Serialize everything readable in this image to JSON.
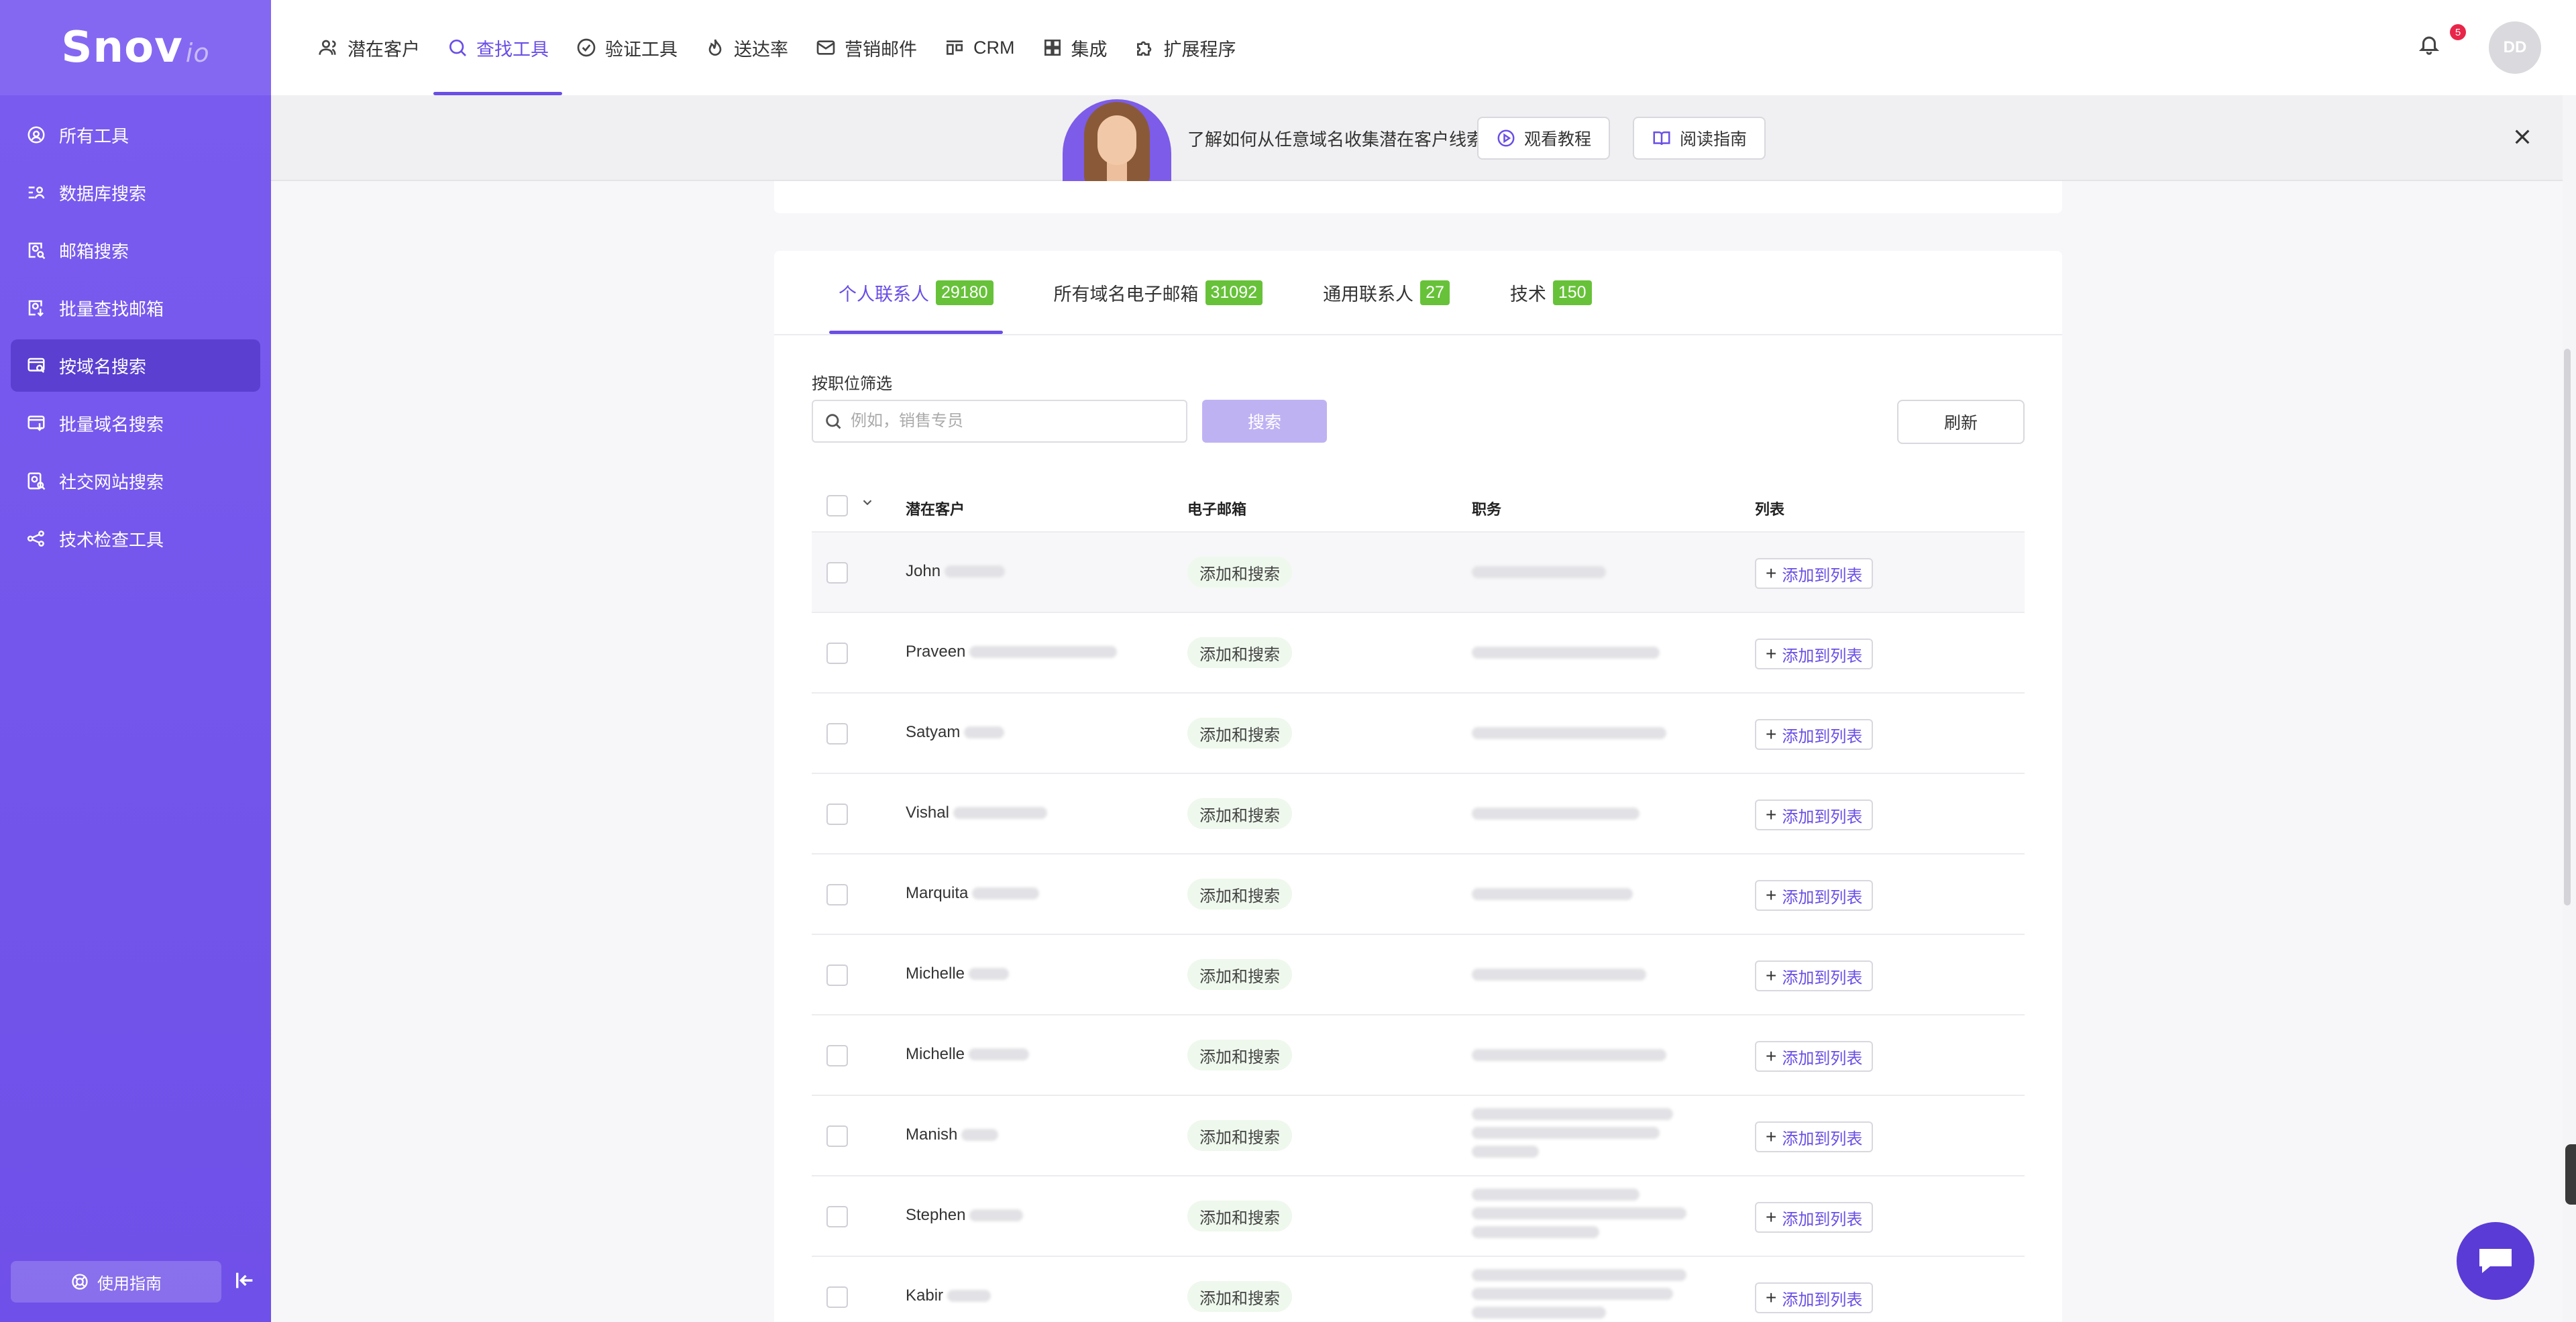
{
  "sidebar": {
    "logo_main": "Snov",
    "logo_suffix": "io",
    "items": [
      {
        "label": "所有工具",
        "icon": "tools-icon"
      },
      {
        "label": "数据库搜索",
        "icon": "database-search-icon"
      },
      {
        "label": "邮箱搜索",
        "icon": "email-search-icon"
      },
      {
        "label": "批量查找邮箱",
        "icon": "bulk-email-icon"
      },
      {
        "label": "按域名搜索",
        "icon": "domain-search-icon",
        "active": true
      },
      {
        "label": "批量域名搜索",
        "icon": "bulk-domain-icon"
      },
      {
        "label": "社交网站搜索",
        "icon": "social-search-icon"
      },
      {
        "label": "技术检查工具",
        "icon": "tech-check-icon"
      }
    ],
    "guide_label": "使用指南"
  },
  "topnav": {
    "tabs": [
      {
        "label": "潜在客户",
        "icon": "users-icon"
      },
      {
        "label": "查找工具",
        "icon": "search-icon",
        "active": true
      },
      {
        "label": "验证工具",
        "icon": "check-circle-icon"
      },
      {
        "label": "送达率",
        "icon": "flame-icon"
      },
      {
        "label": "营销邮件",
        "icon": "mail-icon"
      },
      {
        "label": "CRM",
        "icon": "crm-icon"
      },
      {
        "label": "集成",
        "icon": "grid-icon"
      },
      {
        "label": "扩展程序",
        "icon": "puzzle-icon"
      }
    ],
    "notification_count": "5",
    "avatar_initials": "DD"
  },
  "banner": {
    "text": "了解如何从任意域名收集潜在客户线索",
    "watch_label": "观看教程",
    "read_label": "阅读指南"
  },
  "content_tabs": [
    {
      "label": "个人联系人",
      "count": "29180",
      "active": true
    },
    {
      "label": "所有域名电子邮箱",
      "count": "31092"
    },
    {
      "label": "通用联系人",
      "count": "27"
    },
    {
      "label": "技术",
      "count": "150"
    }
  ],
  "filter": {
    "label": "按职位筛选",
    "placeholder": "例如，销售专员",
    "search_label": "搜索",
    "refresh_label": "刷新"
  },
  "table": {
    "headers": {
      "prospect": "潜在客户",
      "email": "电子邮箱",
      "position": "职务",
      "list": "列表"
    },
    "email_action": "添加和搜索",
    "add_list_label": "添加到列表",
    "rows": [
      {
        "first_name": "John"
      },
      {
        "first_name": "Praveen"
      },
      {
        "first_name": "Satyam"
      },
      {
        "first_name": "Vishal"
      },
      {
        "first_name": "Marquita"
      },
      {
        "first_name": "Michelle"
      },
      {
        "first_name": "Michelle"
      },
      {
        "first_name": "Manish"
      },
      {
        "first_name": "Stephen"
      },
      {
        "first_name": "Kabir"
      }
    ]
  },
  "colors": {
    "sidebar": "#7a5cf0",
    "accent": "#6a4ee6",
    "count_badge": "#67c23a",
    "notification_badge": "#e8264a"
  }
}
